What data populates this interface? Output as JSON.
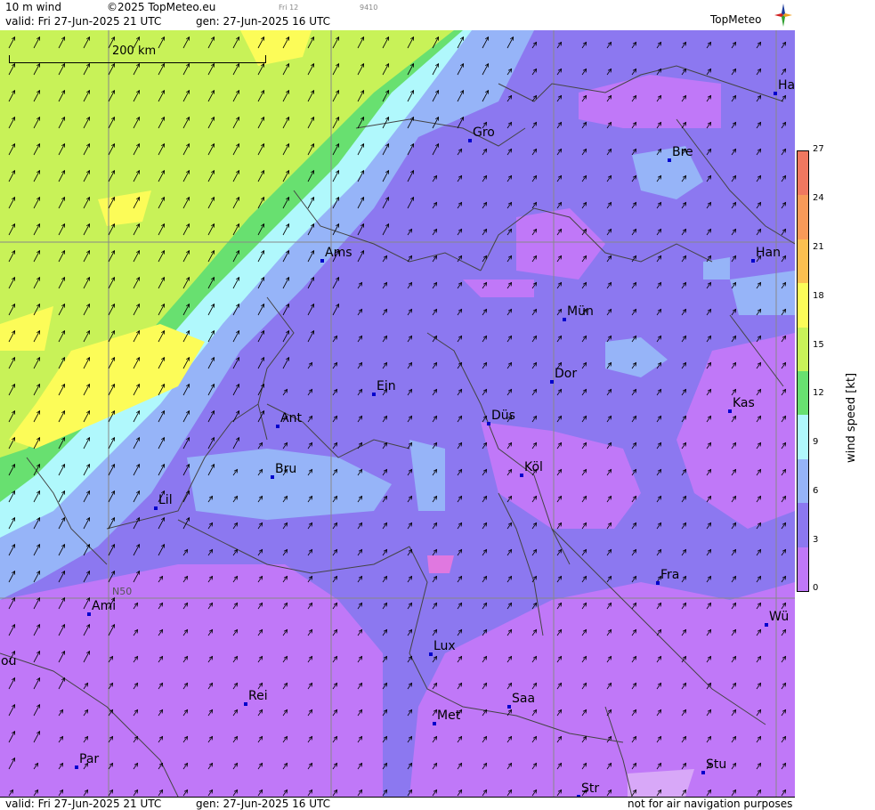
{
  "header": {
    "product": "10 m wind",
    "copyright": "©2025 TopMeteo.eu",
    "day_tag": "Fri 12",
    "code": "9410",
    "valid": "valid:  Fri  27-Jun-2025  21 UTC",
    "gen": "gen: 27-Jun-2025 16 UTC",
    "logo": "TopMeteo"
  },
  "footer": {
    "valid": "valid:  Fri  27-Jun-2025  21 UTC",
    "gen": "gen: 27-Jun-2025 16 UTC",
    "disclaimer": "not for air navigation purposes"
  },
  "scale_bar": {
    "label": "200 km"
  },
  "grid": {
    "lat_label": "N50"
  },
  "cities": [
    {
      "name": "Ha",
      "abbr": "Ha"
    },
    {
      "name": "Gro",
      "abbr": "Gro"
    },
    {
      "name": "Bre",
      "abbr": "Bre"
    },
    {
      "name": "Ams",
      "abbr": "Ams"
    },
    {
      "name": "Han",
      "abbr": "Han"
    },
    {
      "name": "Mün",
      "abbr": "Mün"
    },
    {
      "name": "Ein",
      "abbr": "Ein"
    },
    {
      "name": "Dor",
      "abbr": "Dor"
    },
    {
      "name": "Ant",
      "abbr": "Ant"
    },
    {
      "name": "Düs",
      "abbr": "Düs"
    },
    {
      "name": "Kas",
      "abbr": "Kas"
    },
    {
      "name": "Bru",
      "abbr": "Bru"
    },
    {
      "name": "Köl",
      "abbr": "Köl"
    },
    {
      "name": "Lil",
      "abbr": "Lil"
    },
    {
      "name": "Fra",
      "abbr": "Fra"
    },
    {
      "name": "Ami",
      "abbr": "Ami"
    },
    {
      "name": "Wü",
      "abbr": "Wü"
    },
    {
      "name": "ou",
      "abbr": "ou"
    },
    {
      "name": "Lux",
      "abbr": "Lux"
    },
    {
      "name": "Rei",
      "abbr": "Rei"
    },
    {
      "name": "Saa",
      "abbr": "Saa"
    },
    {
      "name": "Met",
      "abbr": "Met"
    },
    {
      "name": "Par",
      "abbr": "Par"
    },
    {
      "name": "Stu",
      "abbr": "Stu"
    },
    {
      "name": "Str",
      "abbr": "Str"
    }
  ],
  "legend": {
    "title": "wind  speed  [kt]",
    "ticks": [
      "27",
      "24",
      "21",
      "18",
      "15",
      "12",
      "9",
      "6",
      "3",
      "0"
    ],
    "colors": [
      "#f07860",
      "#f89a58",
      "#fcc050",
      "#fcfc58",
      "#c8f258",
      "#68e070",
      "#b0f8fc",
      "#96b4f8",
      "#8c78f0",
      "#c078f8"
    ]
  }
}
